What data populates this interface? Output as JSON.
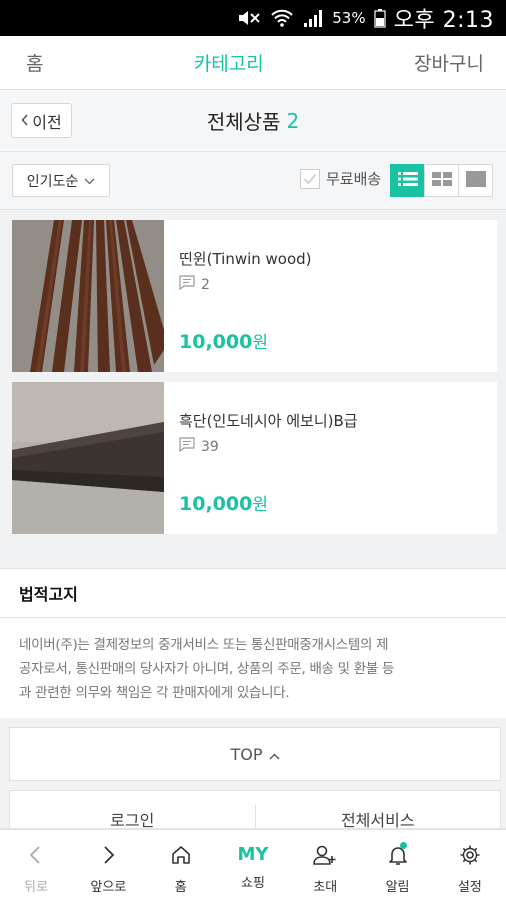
{
  "status_bar": {
    "battery": "53%",
    "time": "오후 2:13"
  },
  "top_nav": {
    "home": "홈",
    "category": "카테고리",
    "cart": "장바구니"
  },
  "title_bar": {
    "back": "이전",
    "title": "전체상품",
    "count": "2"
  },
  "filter": {
    "sort": "인기도순",
    "free_shipping": "무료배송"
  },
  "products": [
    {
      "name": "띤윈(Tinwin wood)",
      "reviews": "2",
      "price": "10,000",
      "currency": "원"
    },
    {
      "name": "흑단(인도네시아 에보니)B급",
      "reviews": "39",
      "price": "10,000",
      "currency": "원"
    }
  ],
  "legal": {
    "heading": "법적고지",
    "lines": [
      "네이버(주)는 결제정보의 중개서비스 또는 통신판매중개시스템의 제",
      "공자로서, 통신판매의 당사자가 아니며, 상품의 주문, 배송 및 환불 등",
      "과 관련한 의무와 책임은 각 판매자에게 있습니다."
    ]
  },
  "top_button": "TOP",
  "footer_links": {
    "login": "로그인",
    "all_services": "전체서비스"
  },
  "bottom_nav": [
    {
      "label": "뒤로",
      "icon": "chevron-left-icon"
    },
    {
      "label": "앞으로",
      "icon": "chevron-right-icon"
    },
    {
      "label": "홈",
      "icon": "home-icon"
    },
    {
      "label": "쇼핑",
      "icon_text": "MY"
    },
    {
      "label": "초대",
      "icon": "invite-user-icon"
    },
    {
      "label": "알림",
      "icon": "bell-icon"
    },
    {
      "label": "설정",
      "icon": "gear-icon"
    }
  ],
  "colors": {
    "accent": "#19c2a0"
  }
}
